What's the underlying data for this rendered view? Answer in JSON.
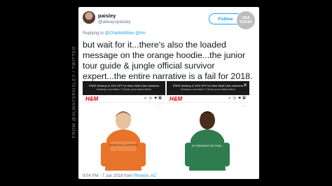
{
  "credit": "FROM @ALWAYSPAISLEY / TWITTER",
  "tweet": {
    "display_name": "paisley",
    "handle": "@alwayspaisley",
    "follow_label": "Follow",
    "replying_prefix": "Replying to ",
    "replying_to": "@CharlieMillow @hm",
    "text": "but wait for it...there's also the loaded message on the orange hoodie...the junior tour guide & jungle official survivor expert...the entire narrative is a fail for 2018.",
    "time": "9:04 PM - 7 Jan 2018 from ",
    "location": "Phoenix, AZ"
  },
  "watermark": {
    "line1": "USA",
    "line2": "TODAY"
  },
  "embedded_screenshots": [
    {
      "banner_line1": "FREE Delivery & 10% OFF for New H&M Club members",
      "banner_line2": "Already a member? Check your latest offers",
      "brand": "H&M",
      "hoodie_color": "#e8732b",
      "hoodie_text": "SURVIVAL EXPERT"
    },
    {
      "banner_line1": "FREE Delivery & 10% OFF for New H&M Club members",
      "banner_line2": "Already a member? Check your latest offers",
      "brand": "H&M",
      "hoodie_color": "#2f7d4f",
      "hoodie_text": "COOLEST MONKEY IN THE JUNGLE"
    }
  ],
  "icons": [
    "search-icon",
    "user-icon",
    "heart-icon",
    "bag-icon",
    "close-icon"
  ],
  "colors": {
    "link": "#1da1f2",
    "hm_red": "#e50010",
    "background": "#000000"
  }
}
